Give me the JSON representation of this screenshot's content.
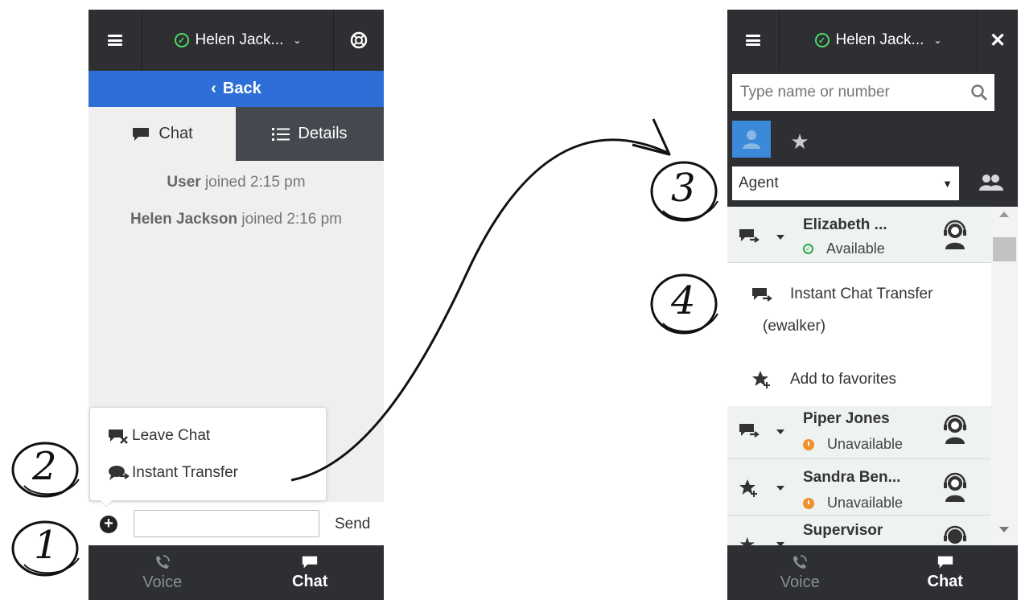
{
  "left_panel": {
    "agent_name": "Helen Jack...",
    "back_label": "Back",
    "tabs": [
      {
        "label": "Chat",
        "icon": "chat-bubble-icon"
      },
      {
        "label": "Details",
        "icon": "list-icon"
      }
    ],
    "messages": [
      {
        "who": "User",
        "text": "joined 2:15 pm"
      },
      {
        "who": "Helen Jackson",
        "text": "joined 2:16 pm"
      }
    ],
    "menu": [
      {
        "label": "Leave Chat",
        "icon": "leave-chat-icon"
      },
      {
        "label": "Instant Transfer",
        "icon": "instant-transfer-icon"
      }
    ],
    "input_value": "",
    "send_label": "Send",
    "bottom_tabs": [
      {
        "label": "Voice",
        "icon": "phone-icon"
      },
      {
        "label": "Chat",
        "icon": "chat-bubble-icon"
      }
    ]
  },
  "right_panel": {
    "agent_name": "Helen Jack...",
    "search_placeholder": "Type name or number",
    "filter_value": "Agent",
    "contacts": [
      {
        "name": "Elizabeth ...",
        "status": "Available",
        "status_color": "#2aa84a",
        "action_icon": "chat-transfer-icon"
      },
      {
        "name": "Piper Jones",
        "status": "Unavailable",
        "status_color": "#f0902a",
        "action_icon": "chat-transfer-icon"
      },
      {
        "name": "Sandra Ben...",
        "status": "Unavailable",
        "status_color": "#f0902a",
        "action_icon": "add-favorite-icon"
      },
      {
        "name": "Supervisor",
        "status": "",
        "status_color": "",
        "action_icon": "favorite-star-icon"
      }
    ],
    "context_menu": [
      {
        "label": "Instant Chat Transfer",
        "label2": "(ewalker)",
        "icon": "chat-transfer-icon"
      },
      {
        "label": "Add to favorites",
        "icon": "add-favorite-icon"
      }
    ],
    "bottom_tabs": [
      {
        "label": "Voice",
        "icon": "phone-icon"
      },
      {
        "label": "Chat",
        "icon": "chat-bubble-icon"
      }
    ]
  },
  "callouts": [
    "1",
    "2",
    "3",
    "4"
  ],
  "colors": {
    "dark": "#2d2f33",
    "blue": "#2d6fd6",
    "green": "#4cd964",
    "orange": "#f0902a"
  }
}
